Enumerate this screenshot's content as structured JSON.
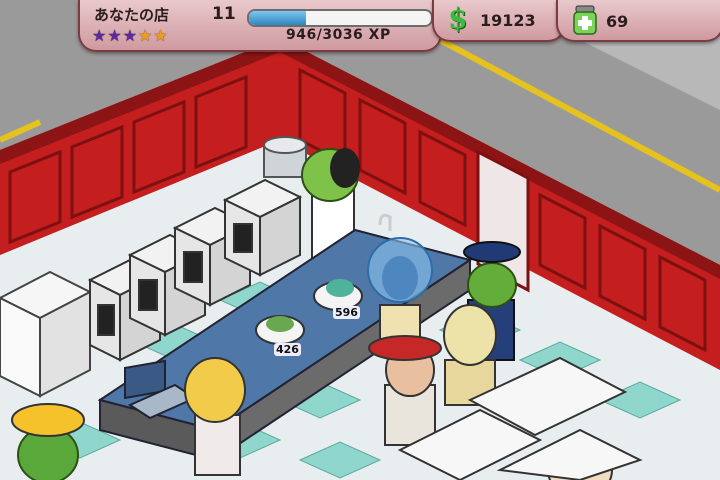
{
  "hud": {
    "restaurant_name": "あなたの店",
    "level": "11",
    "stars_filled": 3,
    "stars_total": 5,
    "xp_text": "946/3036 XP",
    "xp_progress": 0.312,
    "cash_amount": "19123",
    "meds_amount": "69"
  },
  "counter": {
    "dish_prices": [
      "426",
      "596"
    ]
  },
  "colors": {
    "wall_red": "#c51e1e",
    "hud_pink": "#e3b8bc",
    "floor_teal": "#8fd6cc",
    "counter_blue": "#4f77a8",
    "star_purple": "#5e2a9b",
    "star_orange": "#f09a1e",
    "cash_green": "#3dbb3f"
  }
}
